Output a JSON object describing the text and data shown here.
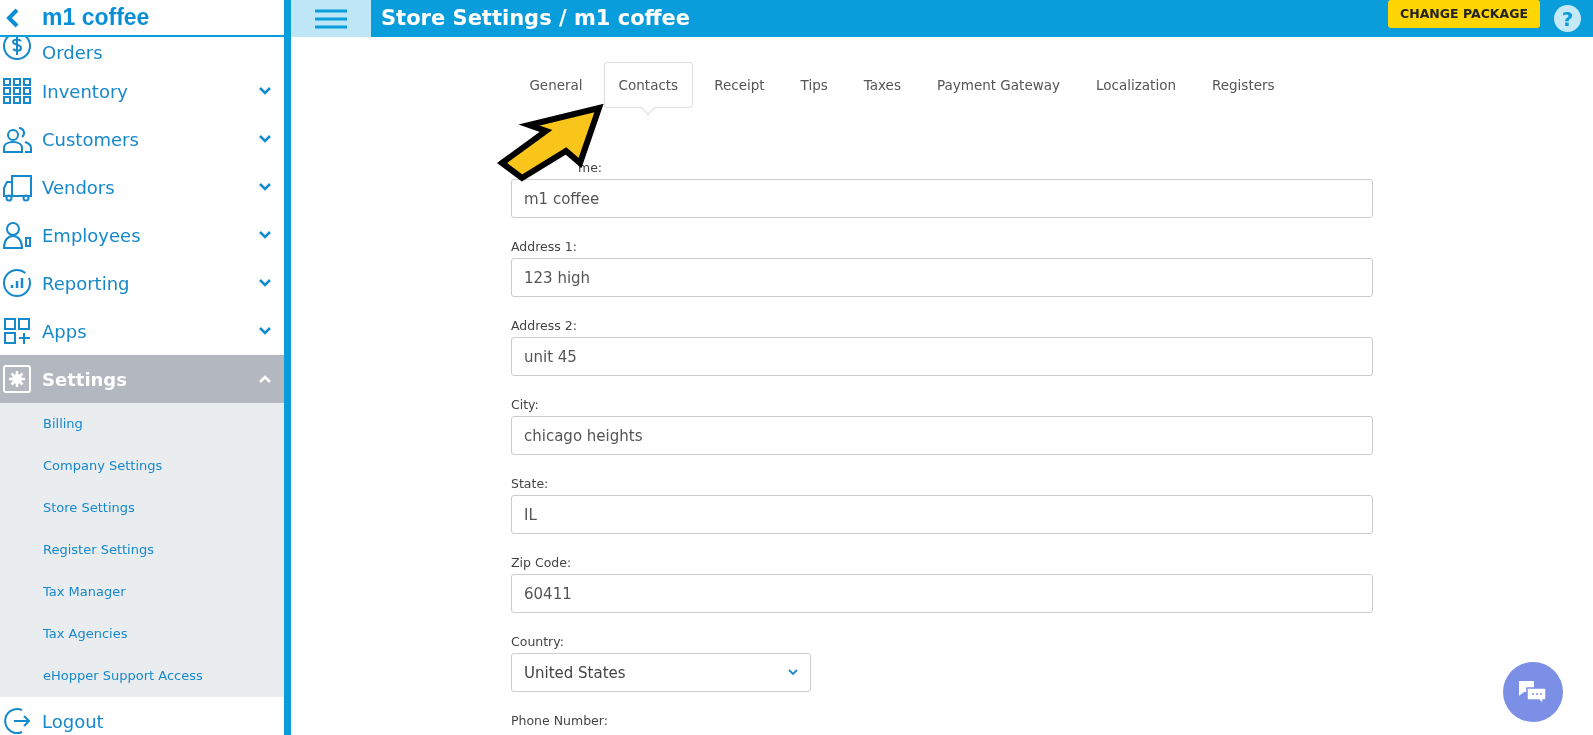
{
  "sidebar": {
    "title": "m1 coffee",
    "items": [
      {
        "label": "Orders",
        "expandable": false,
        "expanded": false
      },
      {
        "label": "Inventory",
        "expandable": true,
        "expanded": false
      },
      {
        "label": "Customers",
        "expandable": true,
        "expanded": false
      },
      {
        "label": "Vendors",
        "expandable": true,
        "expanded": false
      },
      {
        "label": "Employees",
        "expandable": true,
        "expanded": false
      },
      {
        "label": "Reporting",
        "expandable": true,
        "expanded": false
      },
      {
        "label": "Apps",
        "expandable": true,
        "expanded": false
      },
      {
        "label": "Settings",
        "expandable": true,
        "expanded": true,
        "children": [
          {
            "label": "Billing"
          },
          {
            "label": "Company Settings"
          },
          {
            "label": "Store Settings"
          },
          {
            "label": "Register Settings"
          },
          {
            "label": "Tax Manager"
          },
          {
            "label": "Tax Agencies"
          },
          {
            "label": "eHopper Support Access"
          }
        ]
      },
      {
        "label": "Logout",
        "expandable": false,
        "expanded": false
      }
    ]
  },
  "topbar": {
    "title": "Store Settings / m1 coffee",
    "button": "CHANGE PACKAGE",
    "help": "?"
  },
  "tabs": [
    {
      "label": "General",
      "selected": false
    },
    {
      "label": "Contacts",
      "selected": true
    },
    {
      "label": "Receipt",
      "selected": false
    },
    {
      "label": "Tips",
      "selected": false
    },
    {
      "label": "Taxes",
      "selected": false
    },
    {
      "label": "Payment Gateway",
      "selected": false
    },
    {
      "label": "Localization",
      "selected": false
    },
    {
      "label": "Registers",
      "selected": false
    }
  ],
  "form": {
    "fields": [
      {
        "kind": "text",
        "label": "me:",
        "value": "m1 coffee"
      },
      {
        "kind": "text",
        "label": "Address 1:",
        "value": "123 high"
      },
      {
        "kind": "text",
        "label": "Address 2:",
        "value": "unit 45"
      },
      {
        "kind": "text",
        "label": "City:",
        "value": "chicago heights"
      },
      {
        "kind": "text",
        "label": "State:",
        "value": "IL"
      },
      {
        "kind": "text",
        "label": "Zip Code:",
        "value": "60411"
      },
      {
        "kind": "select",
        "label": "Country:",
        "value": "United States"
      },
      {
        "kind": "label",
        "label": "Phone Number:"
      }
    ]
  }
}
